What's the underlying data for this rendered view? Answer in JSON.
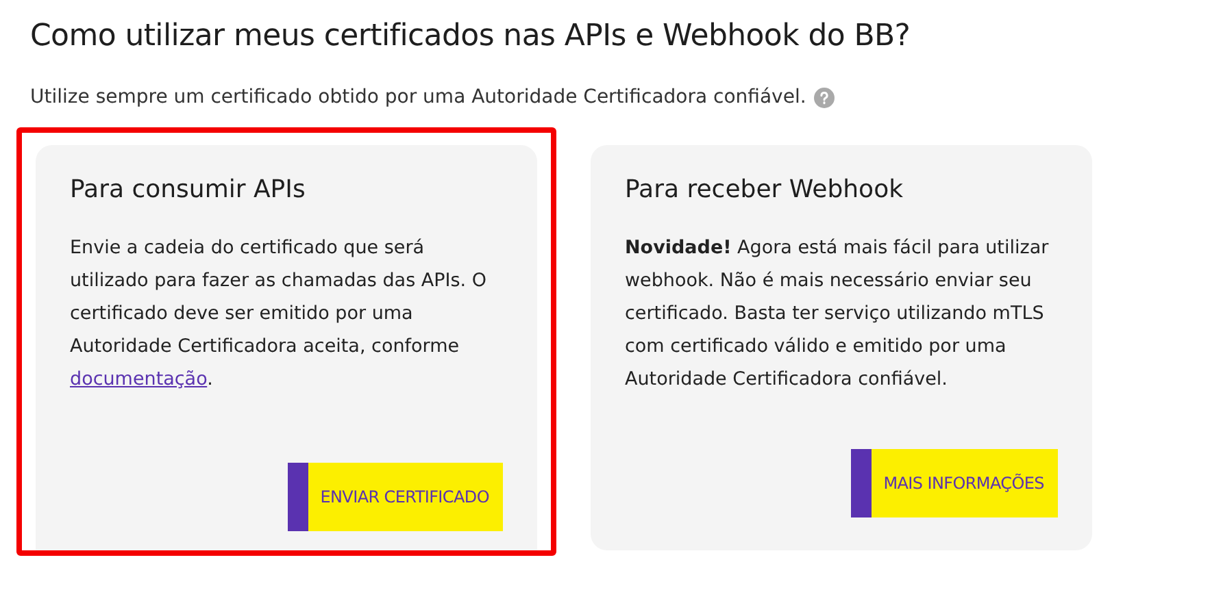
{
  "title": "Como utilizar meus certificados nas APIs e Webhook do BB?",
  "subtitle": "Utilize sempre um certificado obtido por uma Autoridade Certificadora confiável.",
  "cards": [
    {
      "heading": "Para consumir APIs",
      "body": "Envie a cadeia do certificado que será utilizado para fazer as chamadas das APIs. O certificado deve ser emitido por uma Autoridade Certificadora aceita, conforme",
      "link": "documentação",
      "body_end": ".",
      "button": "ENVIAR CERTIFICADO",
      "highlighted": true
    },
    {
      "heading": "Para receber Webhook",
      "body": "**Novidade!** Agora está mais fácil para utilizar webhook. Não é mais necessário enviar seu certificado. Basta ter serviço utilizando mTLS com certificado válido e emitido por uma Autoridade Certificadora confiável.",
      "button": "MAIS INFORMAÇÕES",
      "highlighted": false
    }
  ]
}
